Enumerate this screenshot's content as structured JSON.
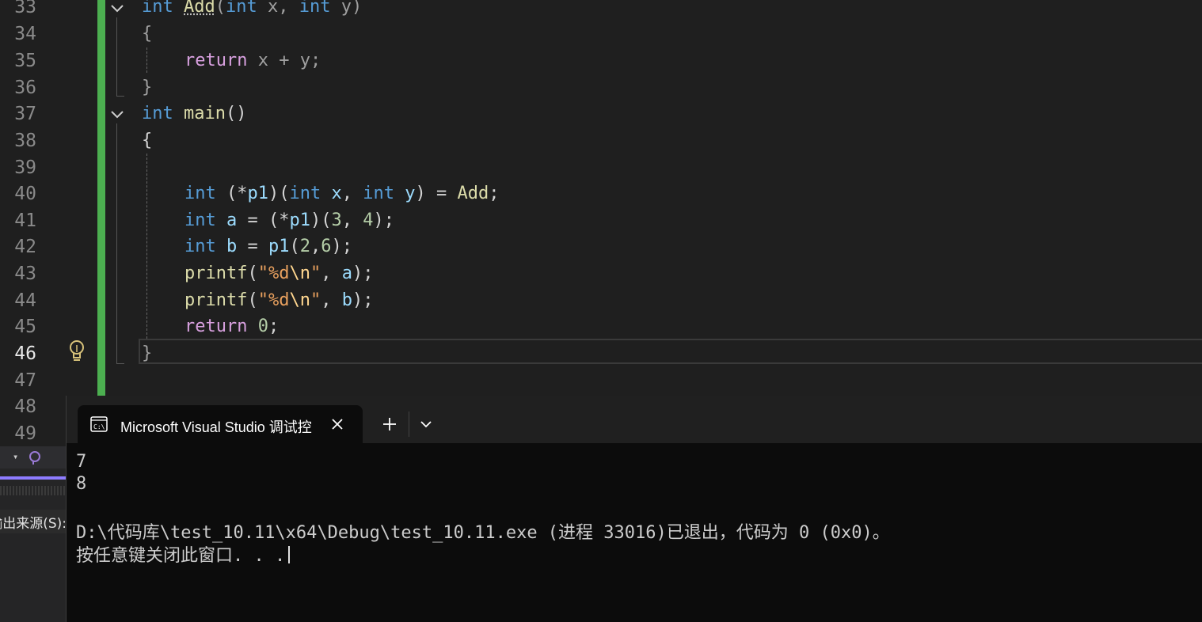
{
  "editor": {
    "line_numbers": [
      "33",
      "34",
      "35",
      "36",
      "37",
      "38",
      "39",
      "40",
      "41",
      "42",
      "43",
      "44",
      "45",
      "46",
      "47",
      "48",
      "49"
    ],
    "current_line": "46",
    "code": {
      "l33": {
        "t1": "int",
        "t2": " ",
        "t3": "Add",
        "t4": "(",
        "t5": "int",
        "t6": " x, ",
        "t7": "int",
        "t8": " y)"
      },
      "l34": {
        "t1": "{"
      },
      "l35": {
        "t1": "return",
        "t2": " x + y;"
      },
      "l36": {
        "t1": "}"
      },
      "l37": {
        "t1": "int",
        "t2": " ",
        "t3": "main",
        "t4": "()"
      },
      "l38": {
        "t1": "{"
      },
      "l40": {
        "t1": "int",
        "t2": " (*",
        "t3": "p1",
        "t4": ")(",
        "t5": "int",
        "t6": " ",
        "t7": "x",
        "t8": ", ",
        "t9": "int",
        "t10": " ",
        "t11": "y",
        "t12": ") = ",
        "t13": "Add",
        "t14": ";"
      },
      "l41": {
        "t1": "int",
        "t2": " ",
        "t3": "a",
        "t4": " = (*",
        "t5": "p1",
        "t6": ")(",
        "t7": "3",
        "t8": ", ",
        "t9": "4",
        "t10": ");"
      },
      "l42": {
        "t1": "int",
        "t2": " ",
        "t3": "b",
        "t4": " = ",
        "t5": "p1",
        "t6": "(",
        "t7": "2",
        "t8": ",",
        "t9": "6",
        "t10": ");"
      },
      "l43": {
        "t1": "printf",
        "t2": "(",
        "t3": "\"%d",
        "t4": "\\n",
        "t5": "\"",
        "t6": ", ",
        "t7": "a",
        "t8": ");"
      },
      "l44": {
        "t1": "printf",
        "t2": "(",
        "t3": "\"%d",
        "t4": "\\n",
        "t5": "\"",
        "t6": ", ",
        "t7": "b",
        "t8": ");"
      },
      "l45": {
        "t1": "return",
        "t2": " ",
        "t3": "0",
        "t4": ";"
      },
      "l46": {
        "t1": "}"
      }
    }
  },
  "sidepanel": {
    "label": "输出来源(S):"
  },
  "terminal": {
    "tab_title": "Microsoft Visual Studio 调试控",
    "tab_icon_text": "C:\\",
    "output_lines": [
      "7",
      "8",
      "",
      "D:\\代码库\\test_10.11\\x64\\Debug\\test_10.11.exe (进程 33016)已退出，代码为 0 (0x0)。",
      "按任意键关闭此窗口. . ."
    ]
  },
  "colors": {
    "editor_bg": "#1f1f1f",
    "change_bar": "#4caf50",
    "terminal_bg": "#0c0c0c",
    "keyword": "#569cd6",
    "function": "#dcdcaa",
    "control": "#d8a0df"
  }
}
